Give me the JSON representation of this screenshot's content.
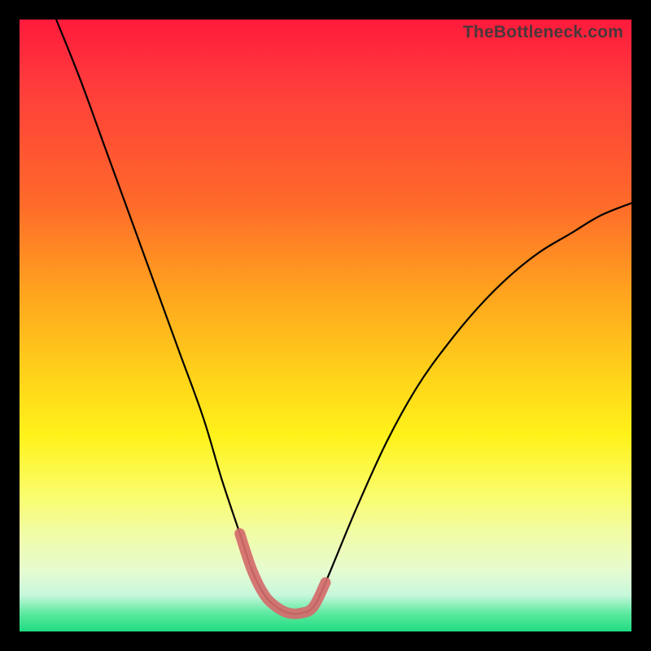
{
  "watermark": "TheBottleneck.com",
  "chart_data": {
    "type": "line",
    "title": "",
    "xlabel": "",
    "ylabel": "",
    "xlim": [
      0,
      100
    ],
    "ylim": [
      0,
      100
    ],
    "grid": false,
    "legend": false,
    "series": [
      {
        "name": "bottleneck-curve",
        "x": [
          6,
          10,
          14,
          18,
          22,
          26,
          30,
          33,
          36,
          38,
          40,
          42,
          44,
          46,
          48,
          50,
          55,
          60,
          65,
          70,
          75,
          80,
          85,
          90,
          95,
          100
        ],
        "y": [
          100,
          90,
          79,
          68,
          57,
          46,
          35,
          25,
          16,
          10,
          6,
          4,
          3,
          3,
          4,
          8,
          20,
          31,
          40,
          47,
          53,
          58,
          62,
          65,
          68,
          70
        ]
      },
      {
        "name": "valley-highlight",
        "x": [
          36,
          38,
          40,
          42,
          44,
          46,
          48,
          50
        ],
        "y": [
          16,
          10,
          6,
          4,
          3,
          3,
          4,
          8
        ]
      }
    ],
    "gradient_stops": [
      {
        "pos": 0.0,
        "color": "#ff1a3c"
      },
      {
        "pos": 0.1,
        "color": "#ff3a3c"
      },
      {
        "pos": 0.3,
        "color": "#ff6a2a"
      },
      {
        "pos": 0.45,
        "color": "#ffa51e"
      },
      {
        "pos": 0.58,
        "color": "#ffd21a"
      },
      {
        "pos": 0.68,
        "color": "#fff21a"
      },
      {
        "pos": 0.78,
        "color": "#fafd6e"
      },
      {
        "pos": 0.84,
        "color": "#f1fca6"
      },
      {
        "pos": 0.9,
        "color": "#e6fbd0"
      },
      {
        "pos": 0.94,
        "color": "#c8f8dc"
      },
      {
        "pos": 0.97,
        "color": "#5ee9a0"
      },
      {
        "pos": 1.0,
        "color": "#1edb80"
      }
    ],
    "annotations": []
  }
}
